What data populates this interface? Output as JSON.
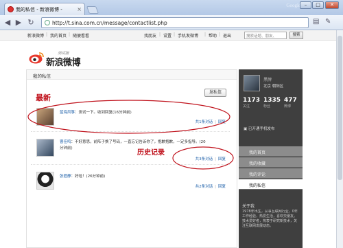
{
  "browser": {
    "tab_title": "我的私信 - 新浪微博 -",
    "google_label": "Google",
    "url": "http://t.sina.com.cn/message/contactlist.php",
    "win_min": "–",
    "win_max": "□",
    "win_close": "✕"
  },
  "sitenav": {
    "left": [
      "新浪微博",
      "我的首页",
      "随便看看"
    ],
    "right": [
      "找朋友",
      "设置",
      "手机发微博",
      "帮助",
      "退出"
    ],
    "search_placeholder": "搜索话题、朋友、",
    "search_button": "搜索"
  },
  "logo": {
    "name": "新浪微博",
    "beta": "测试版"
  },
  "main": {
    "heading": "我的私信",
    "send_button": "发私信"
  },
  "annotations": {
    "newest": "最新",
    "history": "历史记录"
  },
  "messages": [
    {
      "sender": "蓝海风筝",
      "text": "：测试一下。收到回复(16分钟前)",
      "line2": "",
      "count": "共1条对话",
      "reply": "回复"
    },
    {
      "sender": "曹佳鸣",
      "text": "：不好意思，前阵子换了号码，一直忘记告诉你了，抱歉抱歉，一定多指导。(20",
      "line2": "分钟前)",
      "count": "共3条对话",
      "reply": "回复"
    },
    {
      "sender": "张君静",
      "text": "：好哇！(26分钟前)",
      "line2": "",
      "count": "共2条对话",
      "reply": "回复"
    }
  ],
  "sidebar": {
    "name": "黑牌",
    "location": "北京 朝阳区",
    "stats": [
      {
        "num": "1173",
        "label": "关注"
      },
      {
        "num": "1335",
        "label": "粉丝"
      },
      {
        "num": "477",
        "label": "微博"
      }
    ],
    "mobile": "已开通手机发布",
    "menu": [
      "我的首页",
      "我的收藏",
      "我的评论",
      "我的私信"
    ],
    "about_title": "关于我",
    "about_text": "1978年出生，从事互联网行业，0年工作经验，热爱生活，喜欢交朋友。技术爱好者，热衷于研究新技术，关注互联网发展动态。"
  },
  "colors": {
    "annotation_red": "#c0121c",
    "link_blue": "#1b5ea8",
    "sidebar_dark": "#3f3f3f"
  }
}
